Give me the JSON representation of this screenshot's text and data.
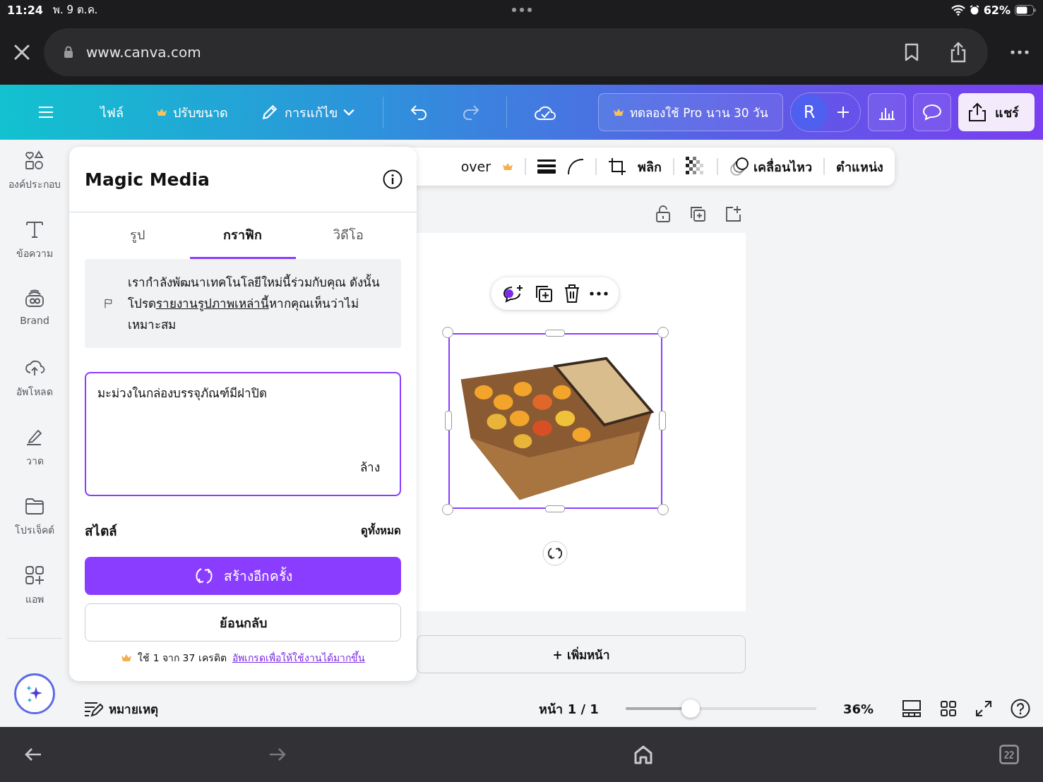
{
  "status_bar": {
    "time": "11:24",
    "date": "พ. 9 ต.ค.",
    "battery": "62%"
  },
  "browser": {
    "url": "www.canva.com"
  },
  "toolbar": {
    "file": "ไฟล์",
    "resize": "ปรับขนาด",
    "edit": "การแก้ไข",
    "trial": "ทดลองใช้ Pro นาน 30 วัน",
    "avatar": "R",
    "share": "แชร์"
  },
  "sidebar": {
    "items": [
      {
        "kind": "elements",
        "label": "องค์ประกอบ"
      },
      {
        "kind": "text",
        "label": "ข้อความ"
      },
      {
        "kind": "brand",
        "label": "Brand"
      },
      {
        "kind": "upload",
        "label": "อัพโหลด"
      },
      {
        "kind": "draw",
        "label": "วาด"
      },
      {
        "kind": "projects",
        "label": "โปรเจ็คต์"
      },
      {
        "kind": "apps",
        "label": "แอพ"
      }
    ]
  },
  "panel": {
    "title": "Magic Media",
    "tabs": [
      {
        "label": "รูป",
        "selected": false
      },
      {
        "label": "กราฟิก",
        "selected": true
      },
      {
        "label": "วิดีโอ",
        "selected": false
      }
    ],
    "notice": "เรากำลังพัฒนาเทคโนโลยีใหม่นี้ร่วมกับคุณ ดังนั้นโปรด",
    "notice_link": "รายงานรูปภาพเหล่านี้",
    "notice_end": "หากคุณเห็นว่าไม่เหมาะสม",
    "prompt": "มะม่วงในกล่องบรรจุภัณฑ์มีฝาปิด",
    "clear": "ล้าง",
    "style_heading": "สไตล์",
    "see_all": "ดูทั้งหมด",
    "generate": "สร้างอีกครั้ง",
    "back": "ย้อนกลับ",
    "credits": "ใช้ 1 จาก 37 เครดิต",
    "upgrade": "อัพเกรดเพื่อให้ใช้งานได้มากขึ้น"
  },
  "element_toolbar": {
    "cut_label": "over",
    "flip": "พลิก",
    "animate": "เคลื่อนไหว",
    "position": "ตำแหน่ง"
  },
  "canvas": {
    "add_page": "+ เพิ่มหน้า"
  },
  "footer": {
    "notes": "หมายเหตุ",
    "page": "หน้า 1 / 1",
    "zoom": {
      "level": 0.34,
      "reading": "36%"
    }
  }
}
